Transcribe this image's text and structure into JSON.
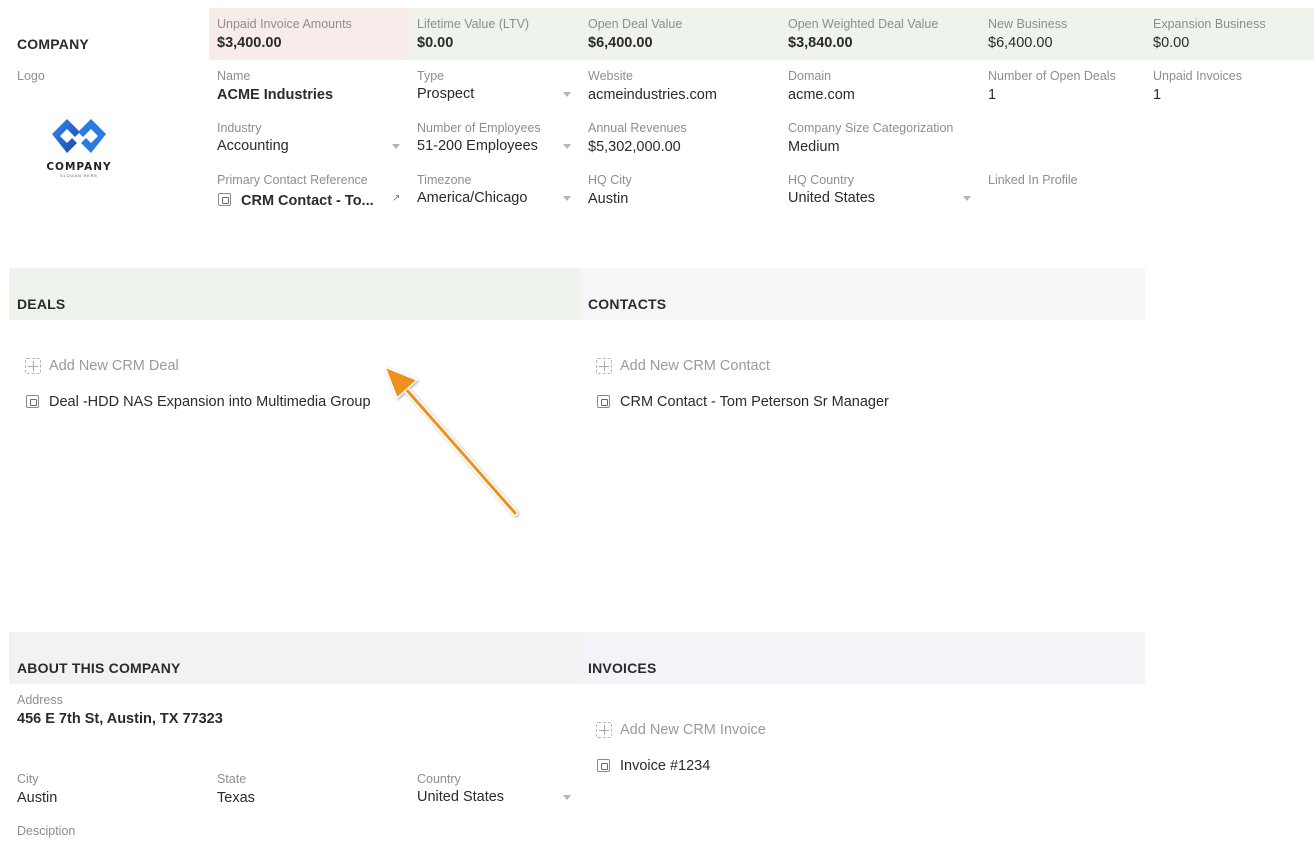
{
  "colors": {
    "unpaid_bg": "#f8ecea",
    "metric_bg": "#eef3ec",
    "deals_bg": "#eef3ec",
    "contacts_bg": "#f6f6f6",
    "about_bg": "#f2f2f0",
    "invoices_bg": "#f4f3f7",
    "arrow": "#f0901e"
  },
  "company": {
    "section_title": "COMPANY",
    "logo_label": "Logo",
    "logo_text": "COMPANY",
    "logo_slogan": "SLOGAN HERE"
  },
  "metrics": [
    {
      "label": "Unpaid Invoice Amounts",
      "value": "$3,400.00"
    },
    {
      "label": "Lifetime Value (LTV)",
      "value": "$0.00"
    },
    {
      "label": "Open Deal Value",
      "value": "$6,400.00"
    },
    {
      "label": "Open Weighted Deal Value",
      "value": "$3,840.00"
    },
    {
      "label": "New Business",
      "value": "$6,400.00"
    },
    {
      "label": "Expansion Business",
      "value": "$0.00"
    }
  ],
  "fields": {
    "name": {
      "label": "Name",
      "value": "ACME Industries"
    },
    "type": {
      "label": "Type",
      "value": "Prospect"
    },
    "website": {
      "label": "Website",
      "value": "acmeindustries.com"
    },
    "domain": {
      "label": "Domain",
      "value": "acme.com"
    },
    "open_deals": {
      "label": "Number of Open Deals",
      "value": "1"
    },
    "unpaid_invoices": {
      "label": "Unpaid Invoices",
      "value": "1"
    },
    "industry": {
      "label": "Industry",
      "value": "Accounting"
    },
    "employees": {
      "label": "Number of Employees",
      "value": "51-200 Employees"
    },
    "revenues": {
      "label": "Annual Revenues",
      "value": "$5,302,000.00"
    },
    "size": {
      "label": "Company Size Categorization",
      "value": "Medium"
    },
    "primary_contact": {
      "label": "Primary Contact Reference",
      "value": "CRM Contact - To..."
    },
    "timezone": {
      "label": "Timezone",
      "value": "America/Chicago"
    },
    "hq_city": {
      "label": "HQ City",
      "value": "Austin"
    },
    "hq_country": {
      "label": "HQ Country",
      "value": "United States"
    },
    "linkedin": {
      "label": "Linked In Profile",
      "value": ""
    }
  },
  "deals": {
    "section_title": "DEALS",
    "add_label": "Add New CRM Deal",
    "items": [
      "Deal -HDD NAS Expansion into Multimedia Group"
    ]
  },
  "contacts": {
    "section_title": "CONTACTS",
    "add_label": "Add New CRM Contact",
    "items": [
      "CRM Contact - Tom Peterson Sr Manager"
    ]
  },
  "about": {
    "section_title": "ABOUT THIS COMPANY",
    "address": {
      "label": "Address",
      "value": "456 E 7th St, Austin, TX 77323"
    },
    "city": {
      "label": "City",
      "value": "Austin"
    },
    "state": {
      "label": "State",
      "value": "Texas"
    },
    "country": {
      "label": "Country",
      "value": "United States"
    },
    "description": {
      "label": "Desciption",
      "value": ""
    }
  },
  "invoices": {
    "section_title": "INVOICES",
    "add_label": "Add New CRM Invoice",
    "items": [
      "Invoice #1234"
    ]
  }
}
